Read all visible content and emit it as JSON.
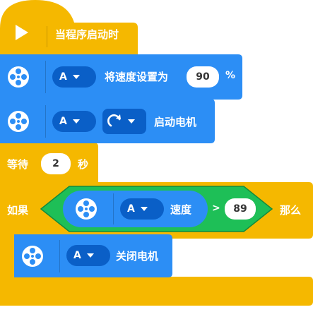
{
  "start_block": {
    "label": "当程序启动时"
  },
  "speed_block": {
    "port": "A",
    "label": "将速度设置为",
    "value": "90",
    "unit": "%"
  },
  "start_motor_block": {
    "port": "A",
    "label": "启动电机"
  },
  "wait_block": {
    "prefix": "等待",
    "value": "2",
    "suffix": "秒"
  },
  "if_block": {
    "if_label": "如果",
    "then_label": "那么"
  },
  "condition": {
    "port": "A",
    "label": "速度",
    "operator": ">",
    "value": "89"
  },
  "stop_motor_block": {
    "port": "A",
    "label": "关闭电机"
  },
  "colors": {
    "event": "#f5b800",
    "motor": "#2c8ef5",
    "motor_dark": "#0a5fc7",
    "operator": "#1ebf57"
  },
  "icons": [
    "play-icon",
    "motor-icon",
    "rotate-clockwise-icon",
    "caret-down-icon"
  ]
}
